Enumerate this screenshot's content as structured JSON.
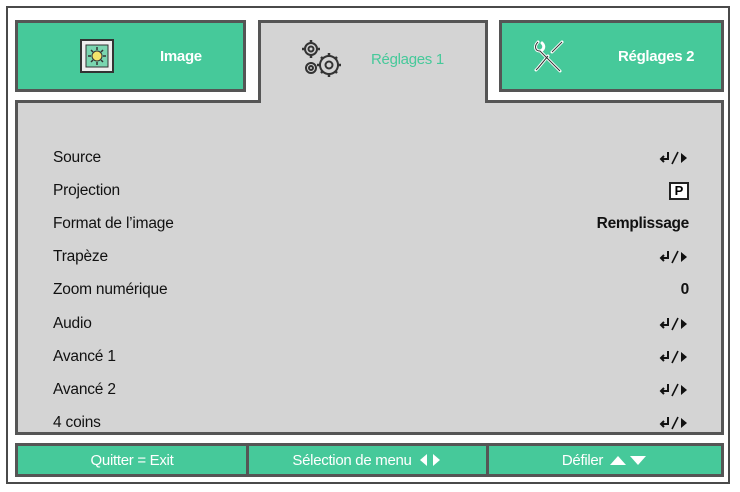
{
  "tabs": [
    {
      "label": "Image",
      "icon": "image-settings-icon",
      "active": false
    },
    {
      "label": "Réglages 1",
      "icon": "gears-icon",
      "active": true
    },
    {
      "label": "Réglages 2",
      "icon": "tools-icon",
      "active": false
    }
  ],
  "menu": {
    "items": [
      {
        "label": "Source",
        "value_icon": "enter-right-icon"
      },
      {
        "label": "Projection",
        "value": "P"
      },
      {
        "label": "Format de l’image",
        "value": "Remplissage"
      },
      {
        "label": "Trapèze",
        "value_icon": "enter-right-icon"
      },
      {
        "label": "Zoom numérique",
        "value": "0"
      },
      {
        "label": "Audio",
        "value_icon": "enter-right-icon"
      },
      {
        "label": "Avancé 1",
        "value_icon": "enter-right-icon"
      },
      {
        "label": "Avancé 2",
        "value_icon": "enter-right-icon"
      },
      {
        "label": "4 coins",
        "value_icon": "enter-right-icon"
      }
    ]
  },
  "footer": {
    "exit": "Quitter = Exit",
    "menu_select": "Sélection de menu",
    "scroll": "Défiler"
  },
  "colors": {
    "accent": "#46c99a",
    "panel": "#d4d4d4",
    "border": "#555555"
  }
}
